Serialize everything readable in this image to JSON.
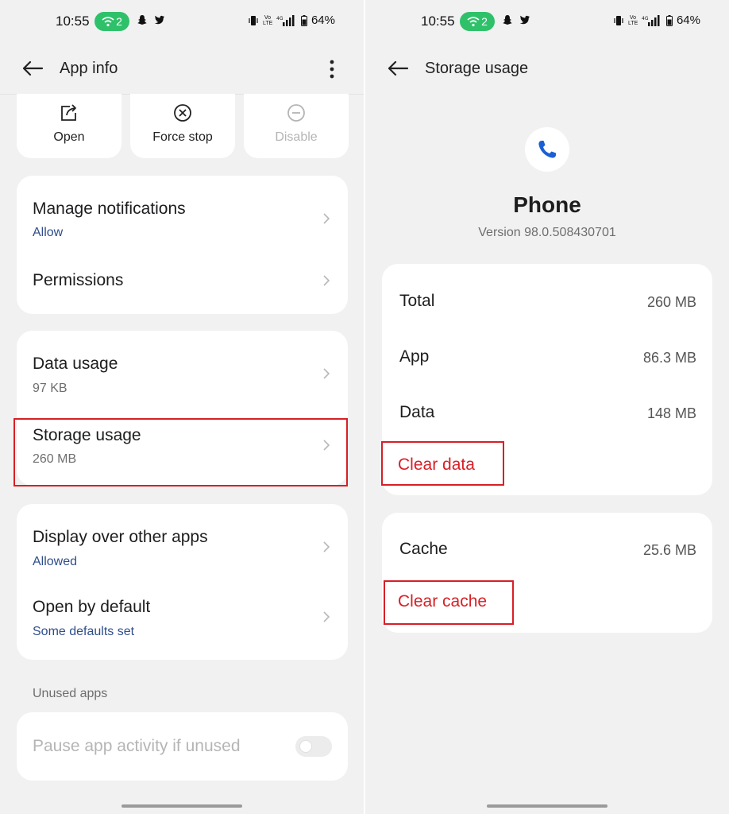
{
  "status_bar": {
    "time": "10:55",
    "hotspot_count": "2",
    "network": "4G",
    "battery": "64%"
  },
  "app_info": {
    "title": "App info",
    "actions": {
      "open": "Open",
      "force_stop": "Force stop",
      "disable": "Disable"
    },
    "manage_notifications": {
      "title": "Manage notifications",
      "sub": "Allow"
    },
    "permissions": {
      "title": "Permissions"
    },
    "data_usage": {
      "title": "Data usage",
      "sub": "97 KB"
    },
    "storage_usage": {
      "title": "Storage usage",
      "sub": "260 MB"
    },
    "display_over_other_apps": {
      "title": "Display over other apps",
      "sub": "Allowed"
    },
    "open_by_default": {
      "title": "Open by default",
      "sub": "Some defaults set"
    },
    "unused_apps_label": "Unused apps",
    "pause_app_activity": {
      "title": "Pause app activity if unused",
      "enabled": false
    }
  },
  "storage": {
    "title": "Storage usage",
    "app_name": "Phone",
    "version": "Version 98.0.508430701",
    "total": {
      "label": "Total",
      "value": "260 MB"
    },
    "app": {
      "label": "App",
      "value": "86.3 MB"
    },
    "data": {
      "label": "Data",
      "value": "148 MB"
    },
    "clear_data": "Clear data",
    "cache": {
      "label": "Cache",
      "value": "25.6 MB"
    },
    "clear_cache": "Clear cache"
  },
  "colors": {
    "accent_blue": "#2f4e8a",
    "highlight_red": "#d81f26",
    "hotspot_green": "#2ec16a",
    "background": "#f1f1f1"
  }
}
